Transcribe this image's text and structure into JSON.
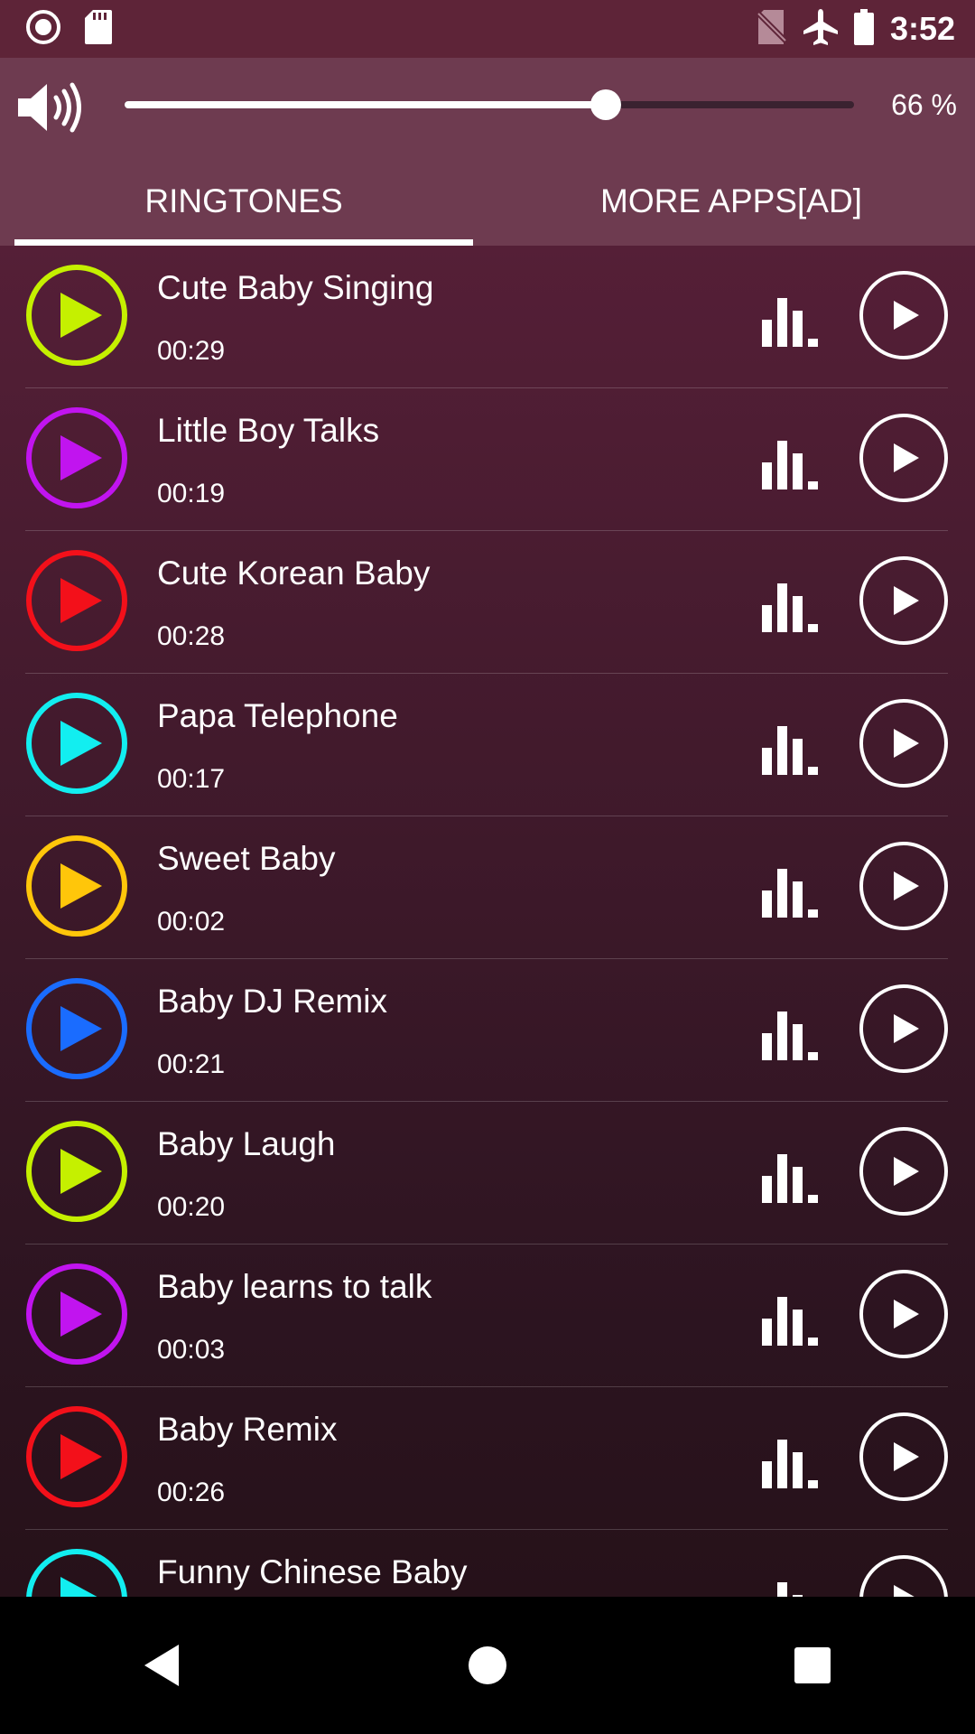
{
  "status_bar": {
    "time": "3:52",
    "left_icons": [
      "record-icon",
      "sd-card-icon"
    ],
    "right_icons": [
      "no-sim-icon",
      "airplane-mode-icon",
      "battery-icon"
    ]
  },
  "volume": {
    "percent_label": "66 %",
    "level": 0.66,
    "icon": "speaker-icon"
  },
  "tabs": [
    {
      "label": "RINGTONES",
      "selected": true
    },
    {
      "label": "MORE APPS[AD]",
      "selected": false
    }
  ],
  "ringtones": [
    {
      "title": "Cute Baby Singing",
      "duration": "00:29",
      "color": "#c5f000"
    },
    {
      "title": "Little Boy Talks",
      "duration": "00:19",
      "color": "#c114ef"
    },
    {
      "title": "Cute Korean Baby",
      "duration": "00:28",
      "color": "#f3101a"
    },
    {
      "title": "Papa Telephone",
      "duration": "00:17",
      "color": "#12eef0"
    },
    {
      "title": "Sweet Baby",
      "duration": "00:02",
      "color": "#ffc60a"
    },
    {
      "title": "Baby DJ Remix",
      "duration": "00:21",
      "color": "#1a6cff"
    },
    {
      "title": "Baby Laugh",
      "duration": "00:20",
      "color": "#c5f000"
    },
    {
      "title": "Baby learns to talk",
      "duration": "00:03",
      "color": "#c114ef"
    },
    {
      "title": "Baby Remix",
      "duration": "00:26",
      "color": "#f3101a"
    },
    {
      "title": "Funny Chinese Baby",
      "duration": "",
      "color": "#12eef0"
    }
  ],
  "nav_bar": {
    "back_icon": "back-icon",
    "home_icon": "home-icon",
    "recents_icon": "recents-icon"
  }
}
